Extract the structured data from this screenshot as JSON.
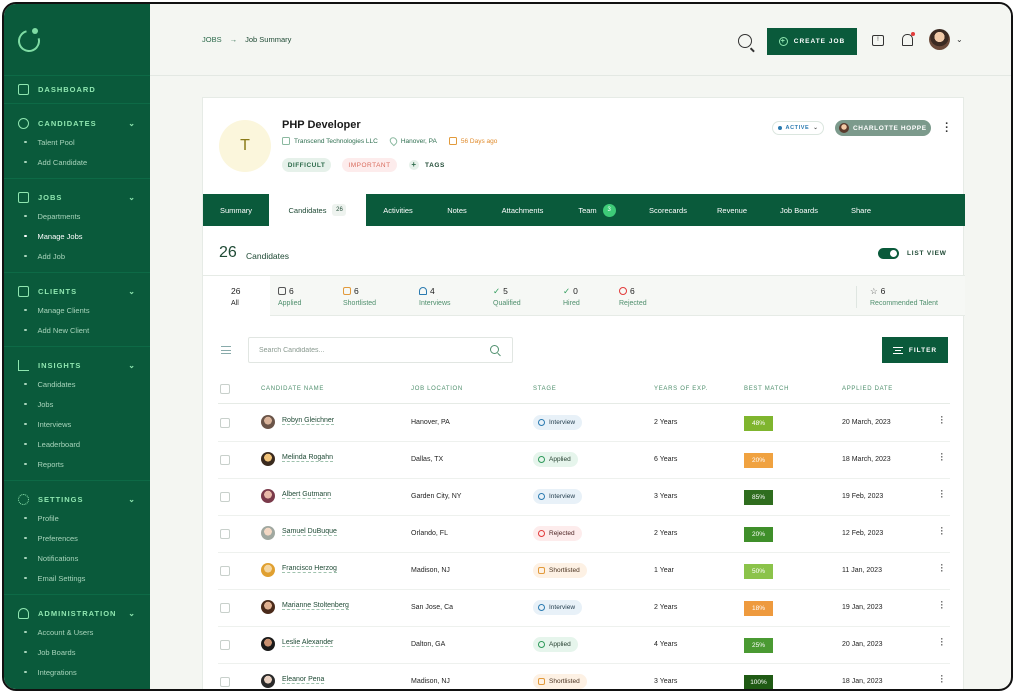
{
  "sidebar": {
    "sections": [
      {
        "id": "dashboard",
        "label": "DASHBOARD",
        "icon": "dashboard-icon",
        "items": []
      },
      {
        "id": "candidates",
        "label": "CANDIDATES",
        "icon": "users-icon",
        "items": [
          {
            "label": "Talent Pool"
          },
          {
            "label": "Add Candidate"
          }
        ]
      },
      {
        "id": "jobs",
        "label": "JOBS",
        "icon": "briefcase-icon",
        "items": [
          {
            "label": "Departments"
          },
          {
            "label": "Manage Jobs",
            "active": true
          },
          {
            "label": "Add Job"
          }
        ]
      },
      {
        "id": "clients",
        "label": "CLIENTS",
        "icon": "building-icon",
        "items": [
          {
            "label": "Manage Clients"
          },
          {
            "label": "Add New Client"
          }
        ]
      },
      {
        "id": "insights",
        "label": "INSIGHTS",
        "icon": "bar-chart-icon",
        "items": [
          {
            "label": "Candidates"
          },
          {
            "label": "Jobs"
          },
          {
            "label": "Interviews"
          },
          {
            "label": "Leaderboard"
          },
          {
            "label": "Reports"
          }
        ]
      },
      {
        "id": "settings",
        "label": "SETTINGS",
        "icon": "gear-icon",
        "items": [
          {
            "label": "Profile"
          },
          {
            "label": "Preferences"
          },
          {
            "label": "Notifications"
          },
          {
            "label": "Email Settings"
          }
        ]
      },
      {
        "id": "administration",
        "label": "ADMINISTRATION",
        "icon": "admin-icon",
        "items": [
          {
            "label": "Account & Users"
          },
          {
            "label": "Job Boards"
          },
          {
            "label": "Integrations"
          }
        ]
      }
    ]
  },
  "topbar": {
    "breadcrumb_root": "JOBS",
    "breadcrumb_sep": "→",
    "breadcrumb_current": "Job Summary",
    "create_job_label": "CREATE JOB"
  },
  "job": {
    "avatar_letter": "T",
    "title": "PHP Developer",
    "company": "Transcend Technologies LLC",
    "location": "Hanover, PA",
    "posted": "56 Days ago",
    "tag_difficult": "DIFFICULT",
    "tag_important": "IMPORTANT",
    "tags_label": "TAGS",
    "status": "ACTIVE",
    "owner": "CHARLOTTE HOPPE"
  },
  "tabs": [
    {
      "label": "Summary"
    },
    {
      "label": "Candidates",
      "badge": "26",
      "active": true
    },
    {
      "label": "Activities"
    },
    {
      "label": "Notes"
    },
    {
      "label": "Attachments"
    },
    {
      "label": "Team",
      "badge": "3"
    },
    {
      "label": "Scorecards"
    },
    {
      "label": "Revenue"
    },
    {
      "label": "Job Boards"
    },
    {
      "label": "Share"
    }
  ],
  "candidates_header": {
    "count": "26",
    "label": "Candidates",
    "list_view": "LIST VIEW"
  },
  "stages": [
    {
      "num": "26",
      "label": "All"
    },
    {
      "num": "6",
      "label": "Applied",
      "icon": "applied-icon"
    },
    {
      "num": "6",
      "label": "Shortlisted",
      "icon": "shortlisted-icon"
    },
    {
      "num": "4",
      "label": "Interviews",
      "icon": "headphones-icon"
    },
    {
      "num": "5",
      "label": "Qualified",
      "icon": "check-icon"
    },
    {
      "num": "0",
      "label": "Hired",
      "icon": "check-icon"
    },
    {
      "num": "6",
      "label": "Rejected",
      "icon": "ban-icon"
    },
    {
      "num": "6",
      "label": "Recommended Talent",
      "icon": "star-icon"
    }
  ],
  "search": {
    "placeholder": "Search Candidates..."
  },
  "filter_label": "FILTER",
  "table": {
    "headers": [
      "CANDIDATE NAME",
      "JOB LOCATION",
      "STAGE",
      "YEARS OF EXP.",
      "BEST MATCH",
      "APPLIED DATE"
    ],
    "rows": [
      {
        "name": "Robyn Gleichner",
        "location": "Hanover, PA",
        "stage": "Interview",
        "exp": "2 Years",
        "match": "48%",
        "date": "20 March, 2023"
      },
      {
        "name": "Melinda Rogahn",
        "location": "Dallas, TX",
        "stage": "Applied",
        "exp": "6 Years",
        "match": "20%",
        "date": "18 March, 2023"
      },
      {
        "name": "Albert Gutmann",
        "location": "Garden City, NY",
        "stage": "Interview",
        "exp": "3 Years",
        "match": "85%",
        "date": "19 Feb, 2023"
      },
      {
        "name": "Samuel DuBuque",
        "location": "Orlando, FL",
        "stage": "Rejected",
        "exp": "2 Years",
        "match": "20%",
        "date": "12 Feb, 2023"
      },
      {
        "name": "Francisco Herzog",
        "location": "Madison, NJ",
        "stage": "Shortlisted",
        "exp": "1 Year",
        "match": "50%",
        "date": "11 Jan, 2023"
      },
      {
        "name": "Marianne Stoltenberg",
        "location": "San Jose, Ca",
        "stage": "Interview",
        "exp": "2 Years",
        "match": "18%",
        "date": "19 Jan, 2023"
      },
      {
        "name": "Leslie Alexander",
        "location": "Dalton, GA",
        "stage": "Applied",
        "exp": "4 Years",
        "match": "25%",
        "date": "20 Jan, 2023"
      },
      {
        "name": "Eleanor Pena",
        "location": "Madison, NJ",
        "stage": "Shortlisted",
        "exp": "3 Years",
        "match": "100%",
        "date": "18 Jan, 2023"
      }
    ]
  },
  "colors": {
    "brand": "#0a5a3b",
    "accent": "#8fe6b0",
    "match_48": "#7fb52e",
    "match_20_orange": "#f0a240",
    "match_85": "#2f6d1e",
    "match_20_green": "#3f8f2a",
    "match_50": "#8bc34a",
    "match_18": "#ee9a3e",
    "match_25": "#4a9a32",
    "match_100": "#1f5a14"
  }
}
